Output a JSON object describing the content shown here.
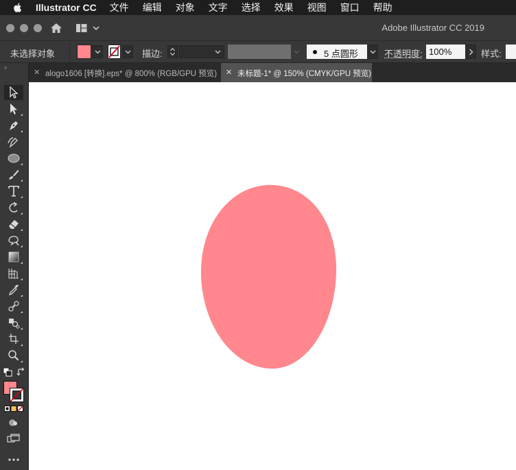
{
  "menubar": {
    "app_name": "Illustrator CC",
    "items": [
      "文件",
      "编辑",
      "对象",
      "文字",
      "选择",
      "效果",
      "视图",
      "窗口",
      "帮助"
    ]
  },
  "titlebar": {
    "title": "Adobe Illustrator CC 2019"
  },
  "control_bar": {
    "selection_label": "未选择对象",
    "fill_color": "#ff878d",
    "stroke_label": "描边:",
    "brush_label": "5 点圆形",
    "opacity_label": "不透明度:",
    "opacity_value": "100%",
    "style_label": "样式:"
  },
  "tabs": [
    {
      "label": "alogo1606 [转换].eps* @ 800% (RGB/GPU 预览)",
      "active": false
    },
    {
      "label": "未标题-1* @ 150% (CMYK/GPU 预览)",
      "active": true
    }
  ],
  "tools": [
    "selection-tool",
    "direct-selection-tool",
    "pen-tool",
    "curvature-tool",
    "ellipse-tool",
    "paintbrush-tool",
    "type-tool",
    "rotate-tool",
    "eraser-tool",
    "warp-tool",
    "gradient-tool",
    "graph-tool",
    "eyedropper-tool",
    "blend-tool",
    "symbol-sprayer-tool",
    "artboard-tool",
    "zoom-tool"
  ],
  "canvas": {
    "shape": "ellipse",
    "fill_color": "#ff878d",
    "background": "#ffffff"
  },
  "colors": {
    "menubar_bg": "#1e1e1e",
    "panel_bg": "#383838",
    "tab_active_bg": "#535353"
  }
}
